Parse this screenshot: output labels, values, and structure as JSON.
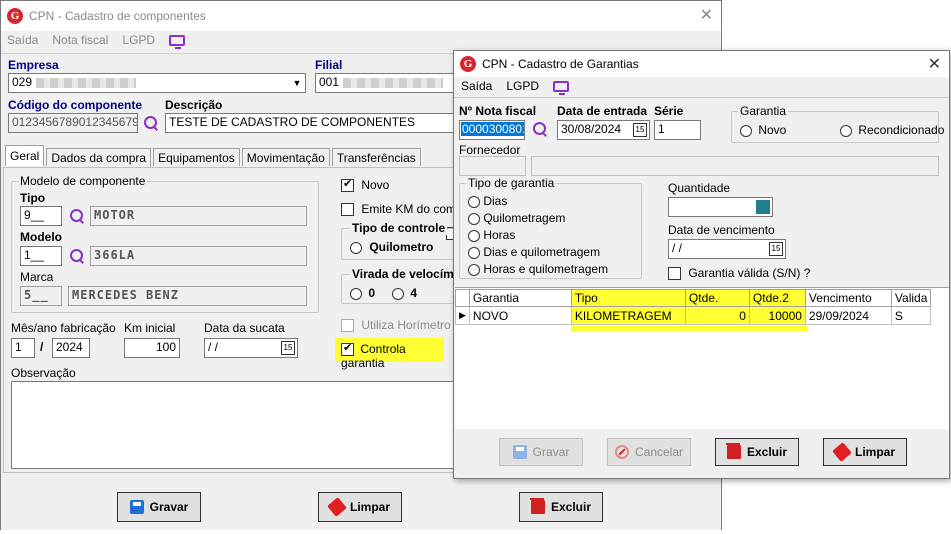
{
  "main": {
    "title": "CPN - Cadastro de componentes",
    "menu": [
      "Saída",
      "Nota fiscal",
      "LGPD"
    ],
    "empresa_label": "Empresa",
    "empresa_value": "029",
    "filial_label": "Filial",
    "filial_value": "001",
    "codigo_label": "Código do componente",
    "codigo_value": "0123456789012345679",
    "descricao_label": "Descrição",
    "descricao_value": "TESTE DE CADASTRO DE COMPONENTES",
    "tabs": [
      "Geral",
      "Dados da compra",
      "Equipamentos",
      "Movimentação",
      "Transferências"
    ],
    "modelo_group": "Modelo de componente",
    "tipo_label": "Tipo",
    "tipo_code": "9__",
    "tipo_desc": "MOTOR",
    "modelo_label": "Modelo",
    "modelo_code": "1__",
    "modelo_desc": "366LA",
    "marca_label": "Marca",
    "marca_code": "5__",
    "marca_desc": "MERCEDES BENZ",
    "novo_label": "Novo",
    "emite_km_label": "Emite KM do compo",
    "tipo_controle_title": "Tipo de controle",
    "tipo_controle_option": "Quilometro",
    "virada_title": "Virada de velocím",
    "virada_options": [
      "0",
      "4"
    ],
    "utiliza_horimetro_label": "Utiliza Horímetro",
    "controla_garantia_label": "Controla garantia",
    "mes_ano_label": "Mês/ano fabricação",
    "mes_value": "1",
    "ano_sep": "/",
    "ano_value": "2024",
    "km_inicial_label": "Km inicial",
    "km_inicial_value": "100",
    "data_sucata_label": "Data da sucata",
    "data_sucata_value": "/ /",
    "observacao_label": "Observação",
    "btn_gravar": "Gravar",
    "btn_limpar": "Limpar",
    "btn_excluir": "Excluir"
  },
  "dialog": {
    "title": "CPN - Cadastro de Garantias",
    "menu": [
      "Saída",
      "LGPD"
    ],
    "nota_fiscal_label": "Nº Nota fiscal",
    "nota_fiscal_value": "0000300801",
    "data_entrada_label": "Data de entrada",
    "data_entrada_value": "30/08/2024",
    "serie_label": "Série",
    "serie_value": "1",
    "garantia_group": "Garantia",
    "garantia_options": [
      "Novo",
      "Recondicionado"
    ],
    "fornecedor_label": "Fornecedor",
    "tipo_garantia_group": "Tipo de garantia",
    "tipo_garantia_options": [
      "Dias",
      "Quilometragem",
      "Horas",
      "Dias e quilometragem",
      "Horas e quilometragem"
    ],
    "quantidade_label": "Quantidade",
    "data_vencimento_label": "Data de vencimento",
    "data_vencimento_value": "/ /",
    "garantia_valida_label": "Garantia válida (S/N) ?",
    "table_headers": [
      "Garantia",
      "Tipo",
      "Qtde.",
      "Qtde.2",
      "Vencimento",
      "Valida"
    ],
    "table_rows": [
      [
        "NOVO",
        "KILOMETRAGEM",
        "0",
        "10000",
        "29/09/2024",
        "S"
      ]
    ],
    "btn_gravar": "Gravar",
    "btn_cancelar": "Cancelar",
    "btn_excluir": "Excluir",
    "btn_limpar": "Limpar"
  },
  "colors": {
    "highlight": "#ffff33",
    "accent_purple": "#8b2fc9",
    "logo_red": "#d8262f",
    "label_blue": "#000080"
  }
}
